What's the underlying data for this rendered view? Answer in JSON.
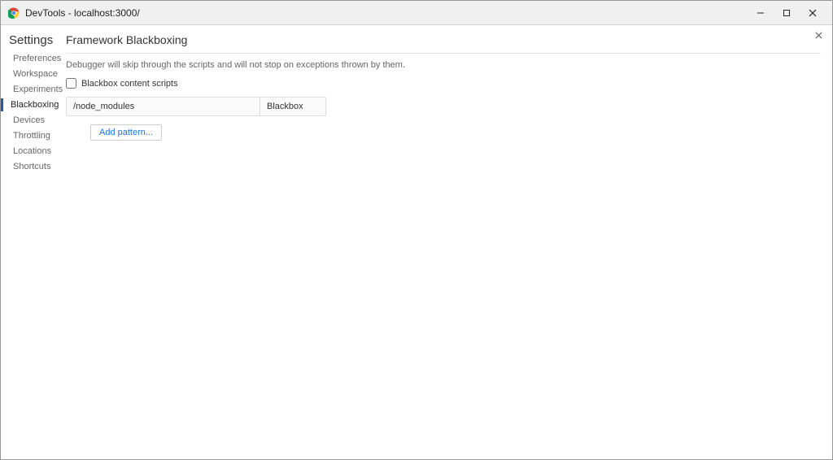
{
  "window": {
    "title": "DevTools - localhost:3000/"
  },
  "sidebar": {
    "header": "Settings",
    "items": [
      {
        "label": "Preferences",
        "active": false
      },
      {
        "label": "Workspace",
        "active": false
      },
      {
        "label": "Experiments",
        "active": false
      },
      {
        "label": "Blackboxing",
        "active": true
      },
      {
        "label": "Devices",
        "active": false
      },
      {
        "label": "Throttling",
        "active": false
      },
      {
        "label": "Locations",
        "active": false
      },
      {
        "label": "Shortcuts",
        "active": false
      }
    ]
  },
  "main": {
    "title": "Framework Blackboxing",
    "description": "Debugger will skip through the scripts and will not stop on exceptions thrown by them.",
    "checkbox_label": "Blackbox content scripts",
    "checkbox_checked": false,
    "patterns": [
      {
        "pattern": "/node_modules",
        "behavior": "Blackbox"
      }
    ],
    "add_button_label": "Add pattern..."
  }
}
